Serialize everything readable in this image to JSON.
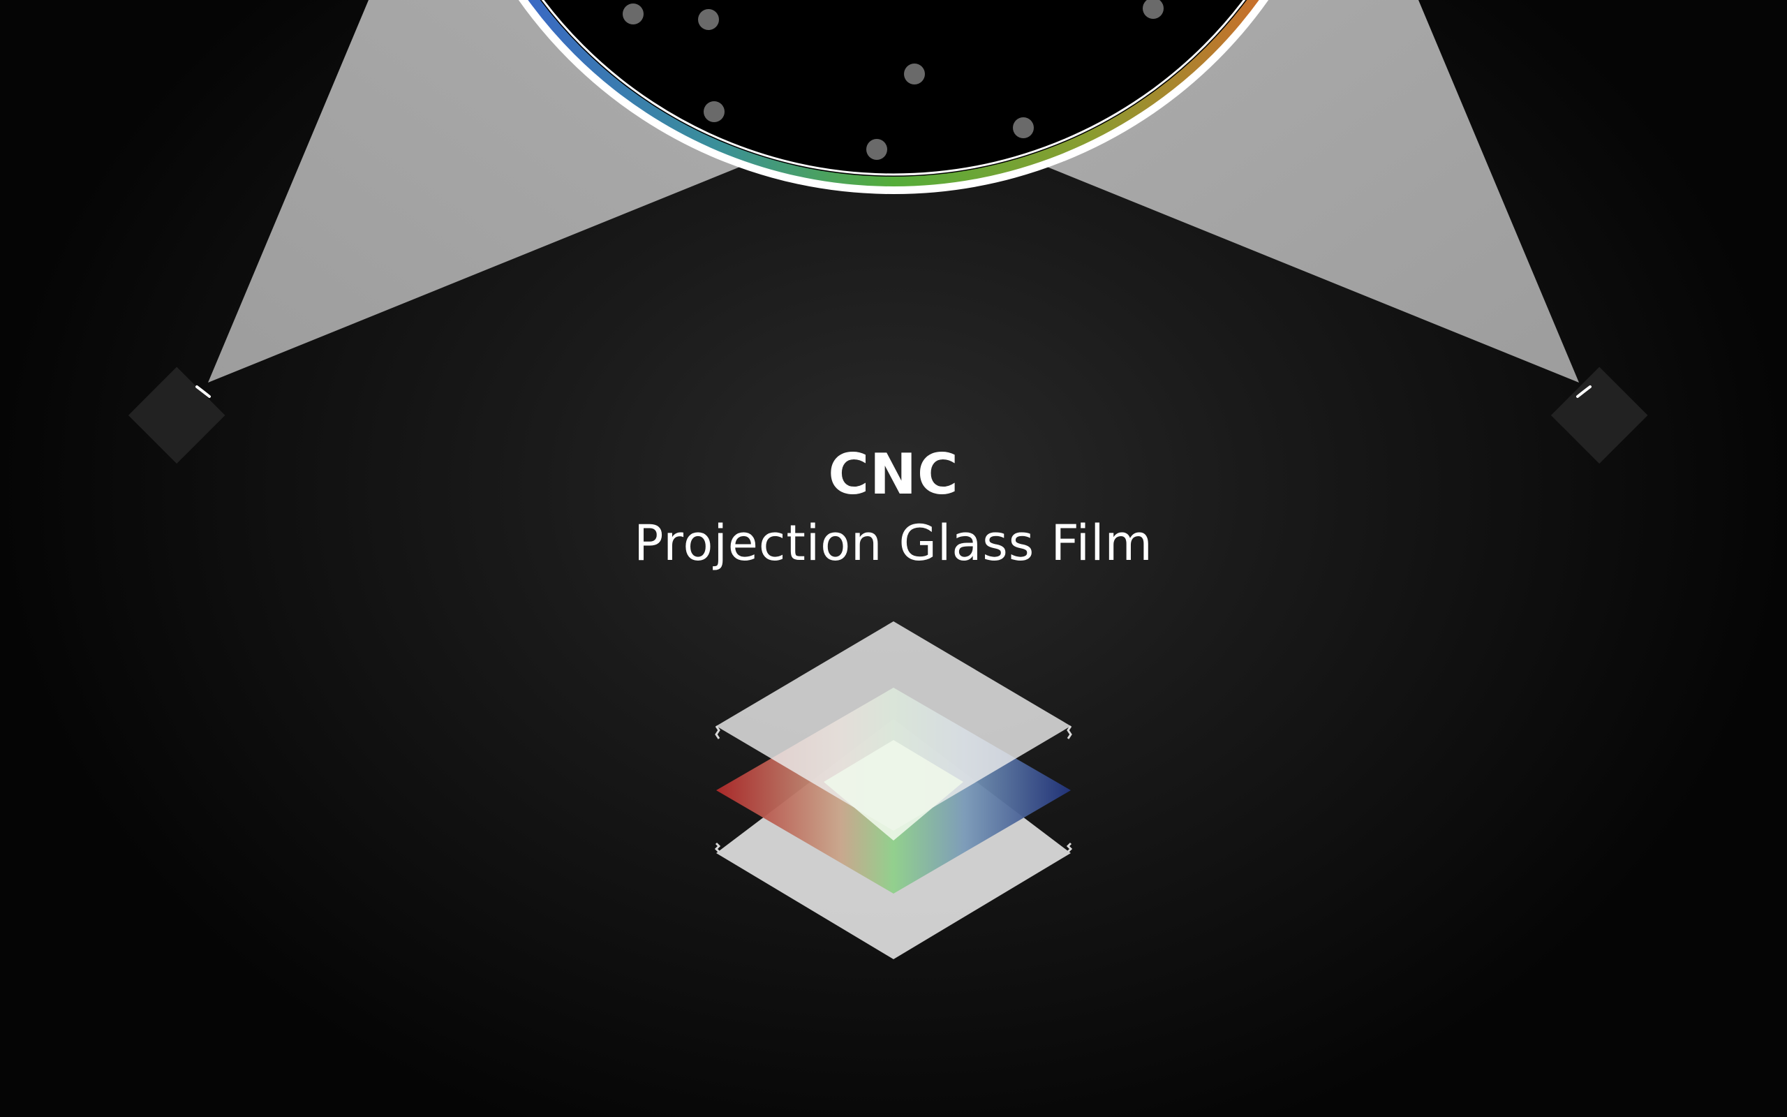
{
  "brand": "CNC",
  "subtitle": "Projection Glass Film",
  "colors": {
    "background_center": "#2a2a2a",
    "background_edge": "#050505",
    "light_beam": "#a3a3a3",
    "projector_body": "#222222",
    "screen_fill": "#000000",
    "ring_blue": "#3f5fd1",
    "ring_green": "#55aa3a",
    "ring_orange": "#e0622c",
    "layer_red": "#a22a2a",
    "layer_green": "#8fd08a",
    "layer_blue": "#24357a",
    "glass_layer": "#d8d8d8"
  },
  "icons": {
    "left_projector": "projector-icon",
    "right_projector": "projector-icon",
    "film_layers": "layered-film-icon"
  }
}
